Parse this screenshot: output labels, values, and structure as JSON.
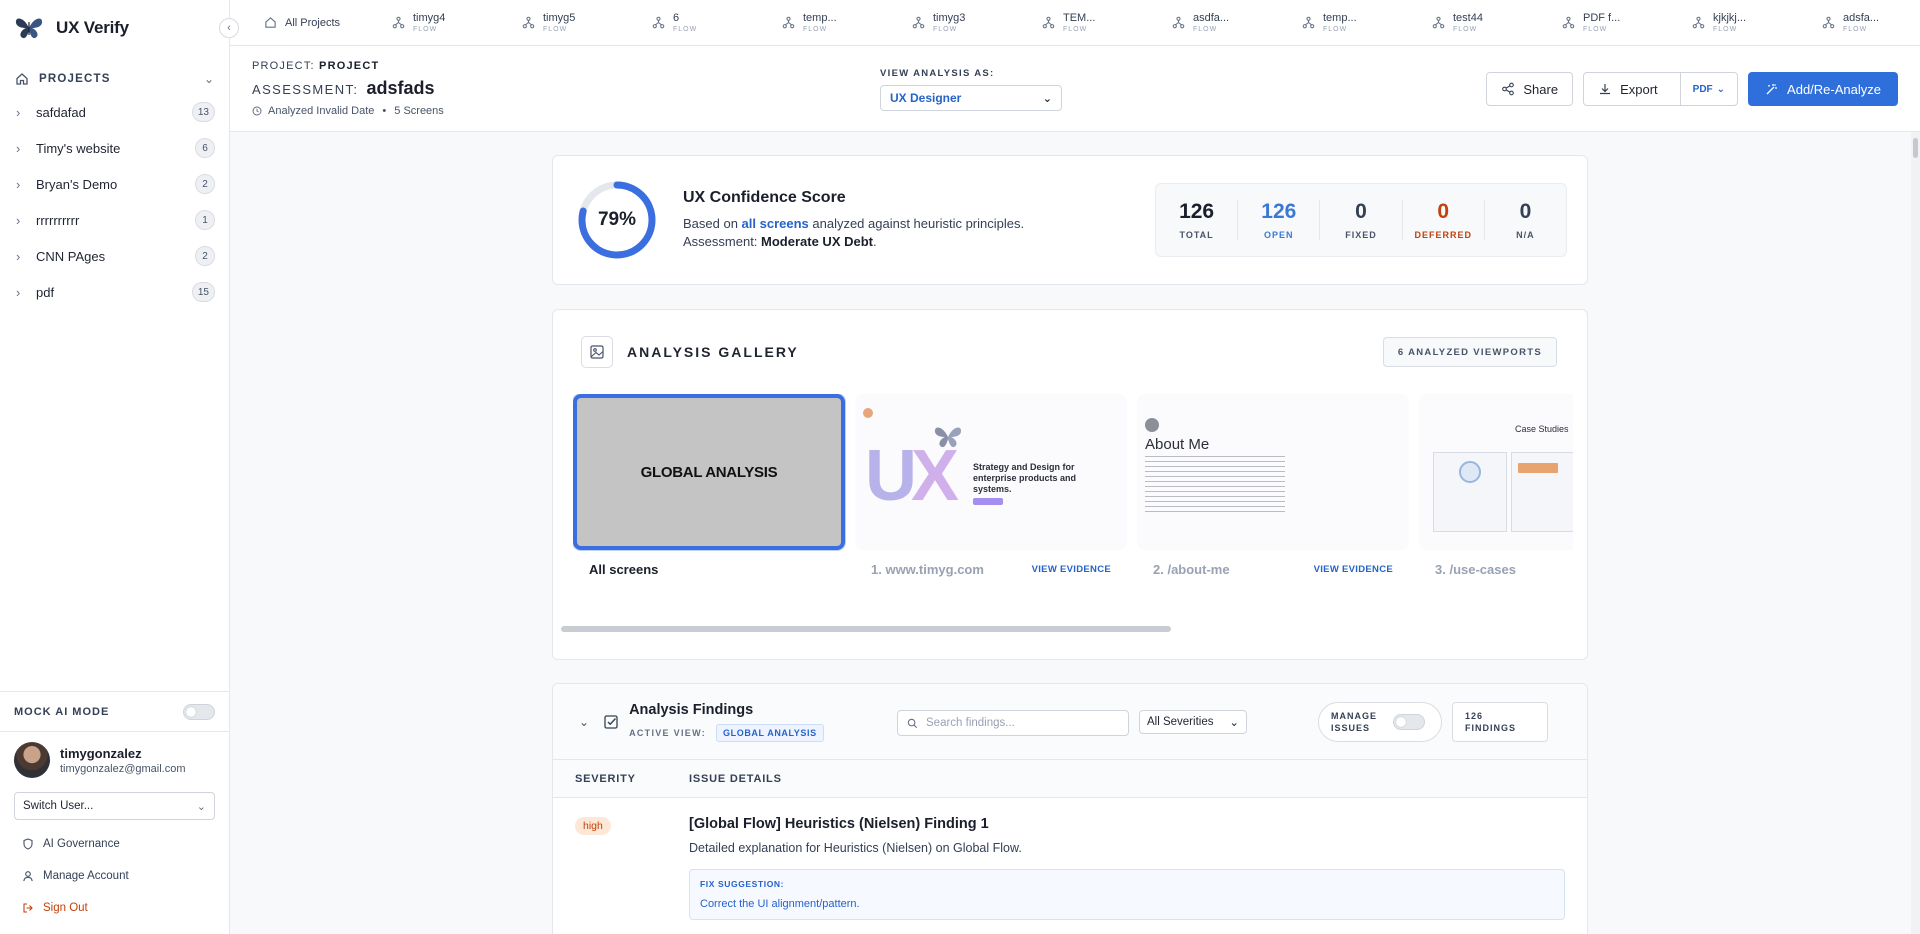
{
  "app": {
    "name": "UX Verify"
  },
  "sidebar": {
    "projects_label": "PROJECTS",
    "projects": [
      {
        "name": "safdafad",
        "count": "13"
      },
      {
        "name": "Timy's website",
        "count": "6"
      },
      {
        "name": "Bryan's Demo",
        "count": "2"
      },
      {
        "name": "rrrrrrrrrr",
        "count": "1"
      },
      {
        "name": "CNN PAges",
        "count": "2"
      },
      {
        "name": "pdf",
        "count": "15"
      }
    ],
    "mock_ai_label": "MOCK AI MODE",
    "user": {
      "name": "timygonzalez",
      "email": "timygonzalez@gmail.com"
    },
    "switch_user": "Switch User...",
    "links": {
      "governance": "AI Governance",
      "account": "Manage Account",
      "signout": "Sign Out"
    }
  },
  "tabs": {
    "all_projects": "All Projects",
    "flow_label": "FLOW",
    "items": [
      "timyg4",
      "timyg5",
      "6",
      "temp...",
      "timyg3",
      "TEM...",
      "asdfa...",
      "temp...",
      "test44",
      "PDF f...",
      "kjkjkj...",
      "adsfa..."
    ]
  },
  "header": {
    "project_key": "PROJECT:",
    "project_value": "PROJECT",
    "assessment_key": "ASSESSMENT:",
    "assessment_value": "adsfads",
    "analyzed": "Analyzed Invalid Date",
    "dot": "•",
    "screens": "5 Screens",
    "view_as_label": "VIEW ANALYSIS AS:",
    "view_as_value": "UX Designer",
    "share": "Share",
    "export": "Export",
    "export_format": "PDF",
    "add_reanalyze": "Add/Re-Analyze"
  },
  "score": {
    "percent": 79,
    "percent_label": "79%",
    "title": "UX Confidence Score",
    "desc_prefix": "Based on ",
    "desc_link": "all screens",
    "desc_suffix": " analyzed against heuristic principles.",
    "assessment_prefix": "Assessment: ",
    "assessment_value": "Moderate UX Debt",
    "assessment_suffix": ".",
    "stats": {
      "total": {
        "value": "126",
        "label": "TOTAL"
      },
      "open": {
        "value": "126",
        "label": "OPEN"
      },
      "fixed": {
        "value": "0",
        "label": "FIXED"
      },
      "deferred": {
        "value": "0",
        "label": "DEFERRED"
      },
      "na": {
        "value": "0",
        "label": "N/A"
      }
    }
  },
  "gallery": {
    "title": "ANALYSIS GALLERY",
    "badge": "6 ANALYZED VIEWPORTS",
    "global_text": "GLOBAL ANALYSIS",
    "items": [
      {
        "name": "All screens"
      },
      {
        "name": "1. www.timyg.com",
        "action": "VIEW EVIDENCE"
      },
      {
        "name": "2. /about-me",
        "action": "VIEW EVIDENCE"
      },
      {
        "name": "3. /use-cases"
      }
    ],
    "thumb_texts": {
      "home_heading": "Strategy and Design for enterprise products and systems.",
      "about_heading": "About Me",
      "cases_heading": "Case Studies"
    }
  },
  "findings": {
    "title": "Analysis Findings",
    "active_view_label": "ACTIVE VIEW:",
    "active_view_value": "GLOBAL ANALYSIS",
    "search_placeholder": "Search findings...",
    "severity_filter": "All Severities",
    "manage_issues_1": "MANAGE",
    "manage_issues_2": "ISSUES",
    "count_1": "126",
    "count_2": "FINDINGS",
    "col_severity": "SEVERITY",
    "col_details": "ISSUE DETAILS",
    "rows": [
      {
        "severity": "high",
        "title": "[Global Flow] Heuristics (Nielsen) Finding 1",
        "desc": "Detailed explanation for Heuristics (Nielsen) on Global Flow.",
        "fix_label": "FIX SUGGESTION:",
        "fix": "Correct the UI alignment/pattern."
      }
    ]
  },
  "colors": {
    "accent": "#2f6fdc",
    "link": "#2563c9",
    "deferred": "#c2410c"
  }
}
